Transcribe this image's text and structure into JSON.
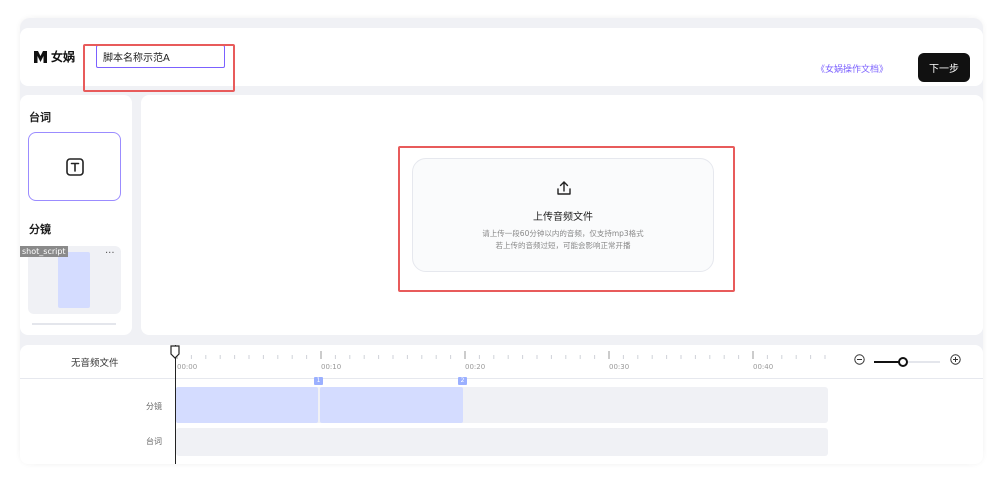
{
  "header": {
    "logo_text": "女娲",
    "script_name_value": "脚本名称示范A",
    "doc_link": "《女娲操作文档》",
    "next_button": "下一步"
  },
  "left_panel": {
    "dialog_title": "台词",
    "storyboard_title": "分镜",
    "shot_tag": "shot_script",
    "more": "···"
  },
  "upload": {
    "title": "上传音频文件",
    "hint_line1": "请上传一段60分钟以内的音频，仅支持mp3格式",
    "hint_line2": "若上传的音频过短，可能会影响正常开播"
  },
  "timeline": {
    "no_audio": "无音频文件",
    "ticks": [
      "00:00",
      "00:10",
      "00:20",
      "00:30",
      "00:40"
    ],
    "track_storyboard": "分镜",
    "track_dialog": "台词",
    "clip_markers": [
      "1",
      "2"
    ],
    "zoom_level": 0.4
  },
  "colors": {
    "accent": "#7b61ff",
    "highlight": "#e85b5b",
    "clip": "#d4dcff",
    "primary_button": "#111111"
  },
  "icons": {
    "logo": "brand-logo-icon",
    "text_tool": "text-icon",
    "upload": "upload-icon",
    "zoom_out": "zoom-out-icon",
    "zoom_in": "zoom-in-icon",
    "playhead": "playhead-icon"
  }
}
